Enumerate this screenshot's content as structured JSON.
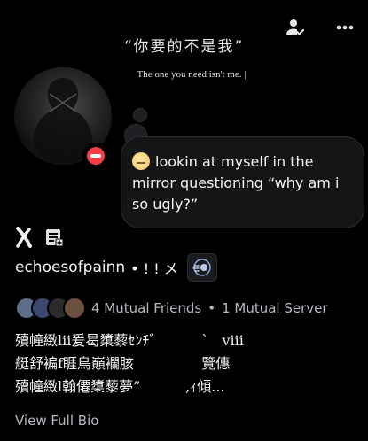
{
  "banner": {
    "quote_cn": "“你要的不是我”",
    "quote_en": "The one you need isn't me. |"
  },
  "top_actions": {
    "friend_icon": "person-check-icon",
    "more_icon": "more-dots-icon"
  },
  "profile": {
    "status": "do-not-disturb",
    "status_color": "#f23f43",
    "custom_status": "lookin at myself in the mirror questioning “why am i so ugly?”",
    "username": "echoesofpainn",
    "pronouns": "• ! ! メ",
    "badges": [
      "x-badge-icon",
      "quest-badge-icon"
    ],
    "nitro_badge": "nitro-orbit-icon"
  },
  "mutuals": {
    "friends": "4 Mutual Friends",
    "separator": "•",
    "servers": "1 Mutual Server"
  },
  "bio": {
    "line1": "殰幢緻lii爰曷橥藜ｾﾝﾁﾞ          ˋ   viii",
    "line2": "艇舒褊f睚鳥巔襴胲               覽僡",
    "line3": "殰幢緻l翰僊橥藜夢”          ,ｨ傾...",
    "view_full": "View Full Bio"
  }
}
